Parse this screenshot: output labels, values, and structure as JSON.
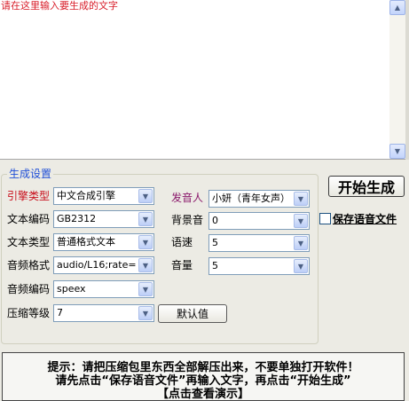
{
  "text_input": {
    "placeholder": "请在这里输入要生成的文字"
  },
  "group_title": "生成设置",
  "fields": {
    "engine": {
      "label": "引擎类型",
      "value": "中文合成引擎"
    },
    "encoding": {
      "label": "文本编码",
      "value": "GB2312"
    },
    "text_type": {
      "label": "文本类型",
      "value": "普通格式文本"
    },
    "audio_format": {
      "label": "音频格式",
      "value": "audio/L16;rate="
    },
    "audio_codec": {
      "label": "音频编码",
      "value": "speex"
    },
    "compression": {
      "label": "压缩等级",
      "value": "7"
    },
    "speaker": {
      "label": "发音人",
      "value": "小妍（青年女声）"
    },
    "bg_sound": {
      "label": "背景音",
      "value": "0"
    },
    "speed": {
      "label": "语速",
      "value": "5"
    },
    "volume": {
      "label": "音量",
      "value": "5"
    }
  },
  "buttons": {
    "default": "默认值",
    "start": "开始生成"
  },
  "save_audio_label": "保存语音文件",
  "hint": {
    "line1": "提示：请把压缩包里东西全部解压出来，不要单独打开软件！",
    "line2": "请先点击“保存语音文件”再输入文字，再点击“开始生成”",
    "line3": "【点击查看演示】"
  },
  "icons": {
    "scroll_up": "scroll-up-arrow",
    "scroll_down": "scroll-down-arrow",
    "dropdown": "chevron-down"
  },
  "colors": {
    "placeholder_text": "#d81e2a",
    "group_title": "#1f4fd7",
    "engine_label": "#c80e1b",
    "speaker_label": "#8b1a6c"
  }
}
